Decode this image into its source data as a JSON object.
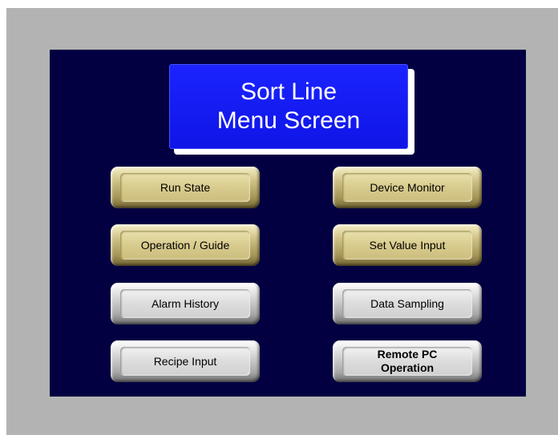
{
  "title": {
    "line1": "Sort Line",
    "line2": "Menu Screen"
  },
  "buttons": {
    "run_state": "Run State",
    "device_monitor": "Device Monitor",
    "operation_guide": "Operation / Guide",
    "set_value_input": "Set Value Input",
    "alarm_history": "Alarm History",
    "data_sampling": "Data Sampling",
    "recipe_input": "Recipe Input",
    "remote_pc_operation": "Remote PC\nOperation"
  },
  "colors": {
    "screen_background": "#030042",
    "title_panel": "#1b24ff",
    "outer_frame": "#b3b3b3",
    "gold_button": "#d8cb8d",
    "silver_button": "#dcdcdc"
  }
}
